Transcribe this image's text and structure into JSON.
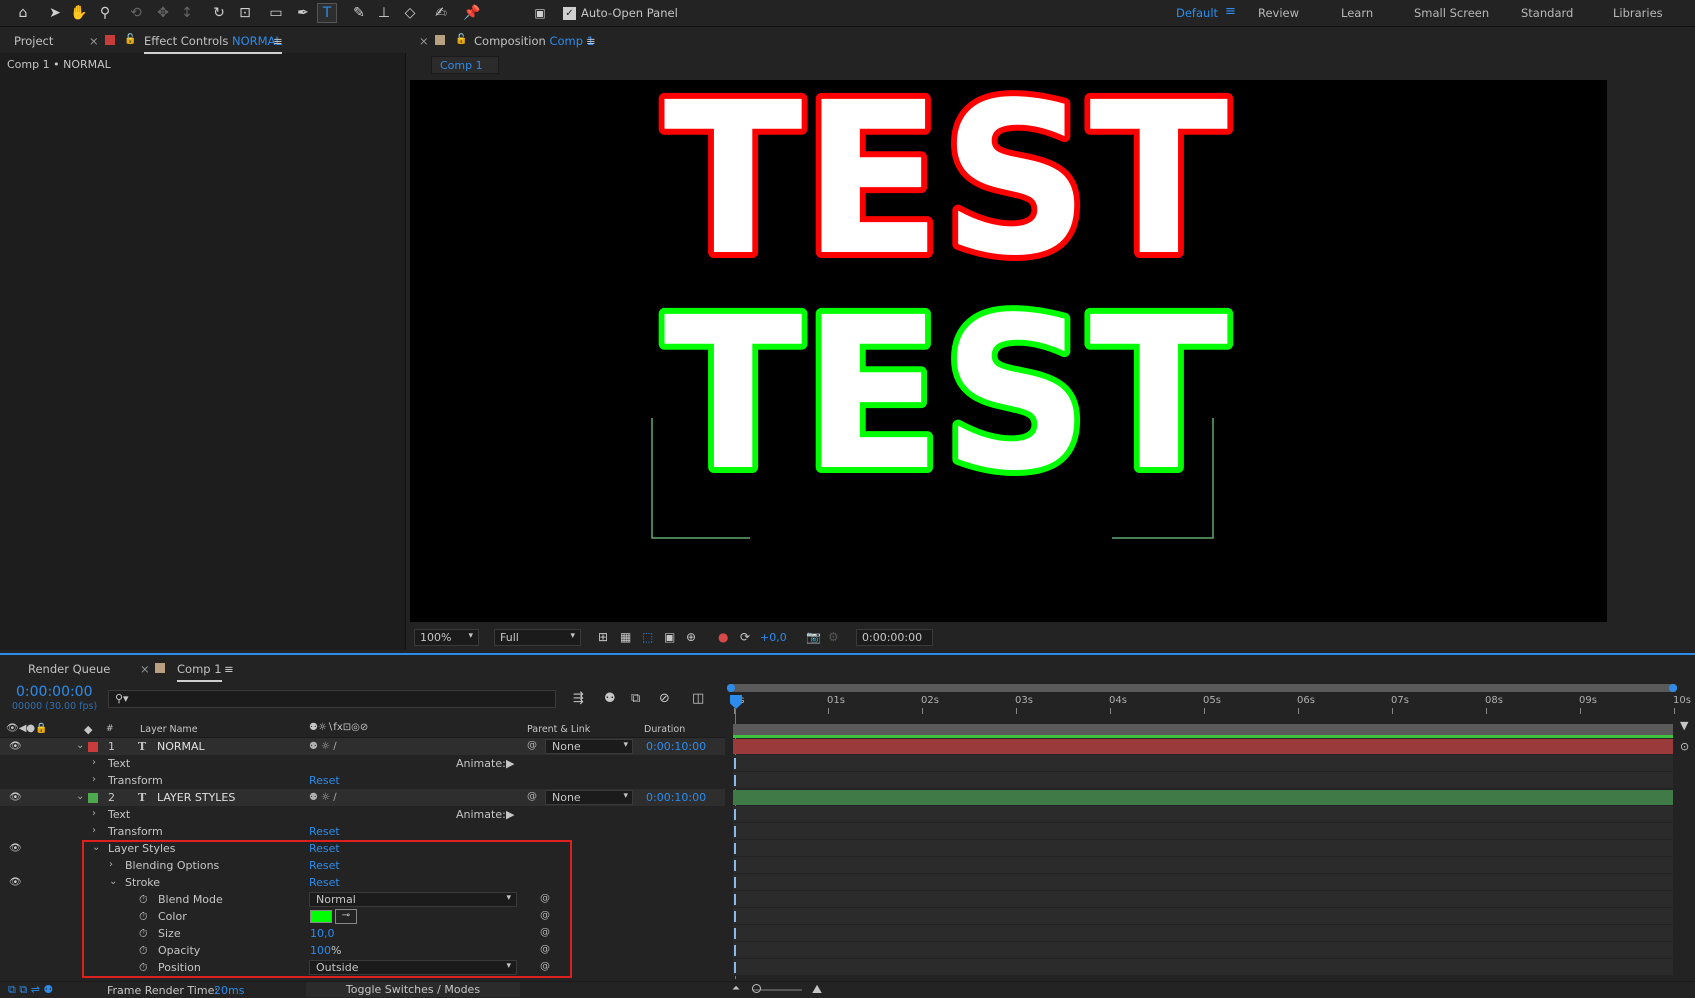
{
  "workspaces": {
    "items": [
      "Default",
      "Review",
      "Learn",
      "Small Screen",
      "Standard",
      "Libraries"
    ]
  },
  "toolbar": {
    "auto_open_label": "Auto-Open Panel"
  },
  "left_panel": {
    "project_tab": "Project",
    "effect_controls_prefix": "Effect Controls",
    "effect_controls_layer": "NORMAL",
    "breadcrumb": "Comp 1 • NORMAL"
  },
  "comp_panel": {
    "tab_prefix": "Composition",
    "tab_name": "Comp 1",
    "sub_tab": "Comp 1"
  },
  "canvas": {
    "line1": "TEST",
    "line2": "TEST",
    "line1_stroke": "#ff0000",
    "line2_stroke": "#00ff00",
    "fill": "#ffffff"
  },
  "viewer_bar": {
    "zoom": "100%",
    "resolution": "Full",
    "exposure": "+0,0",
    "timecode": "0:00:00:00"
  },
  "timeline": {
    "tabs": [
      "Render Queue",
      "Comp 1"
    ],
    "current_time": "0:00:00:00",
    "frame_info": "00000 (30.00 fps)",
    "search_placeholder": "",
    "headers": {
      "num": "#",
      "layer_name": "Layer Name",
      "parent": "Parent & Link",
      "duration": "Duration"
    },
    "ruler": [
      "0s",
      "01s",
      "02s",
      "03s",
      "04s",
      "05s",
      "06s",
      "07s",
      "08s",
      "09s",
      "10s"
    ],
    "layers": [
      {
        "num": "1",
        "name": "NORMAL",
        "color": "#c83c3c",
        "parent": "None",
        "duration": "0:00:10:00",
        "bar_color": "#9a3a3a"
      },
      {
        "num": "2",
        "name": "LAYER STYLES",
        "color": "#4ea84e",
        "parent": "None",
        "duration": "0:00:10:00",
        "bar_color": "#3f7a47"
      }
    ],
    "props": {
      "text": "Text",
      "transform": "Transform",
      "reset": "Reset",
      "animate": "Animate:",
      "layer_styles": "Layer Styles",
      "blending_options": "Blending Options",
      "stroke": "Stroke",
      "blend_mode": "Blend Mode",
      "blend_mode_value": "Normal",
      "color": "Color",
      "color_value": "#00ff00",
      "size": "Size",
      "size_value": "10,0",
      "opacity": "Opacity",
      "opacity_value": "100",
      "opacity_unit": "%",
      "position": "Position",
      "position_value": "Outside"
    },
    "footer": {
      "render_label": "Frame Render Time:",
      "render_value": "20ms",
      "toggle": "Toggle Switches / Modes"
    }
  }
}
